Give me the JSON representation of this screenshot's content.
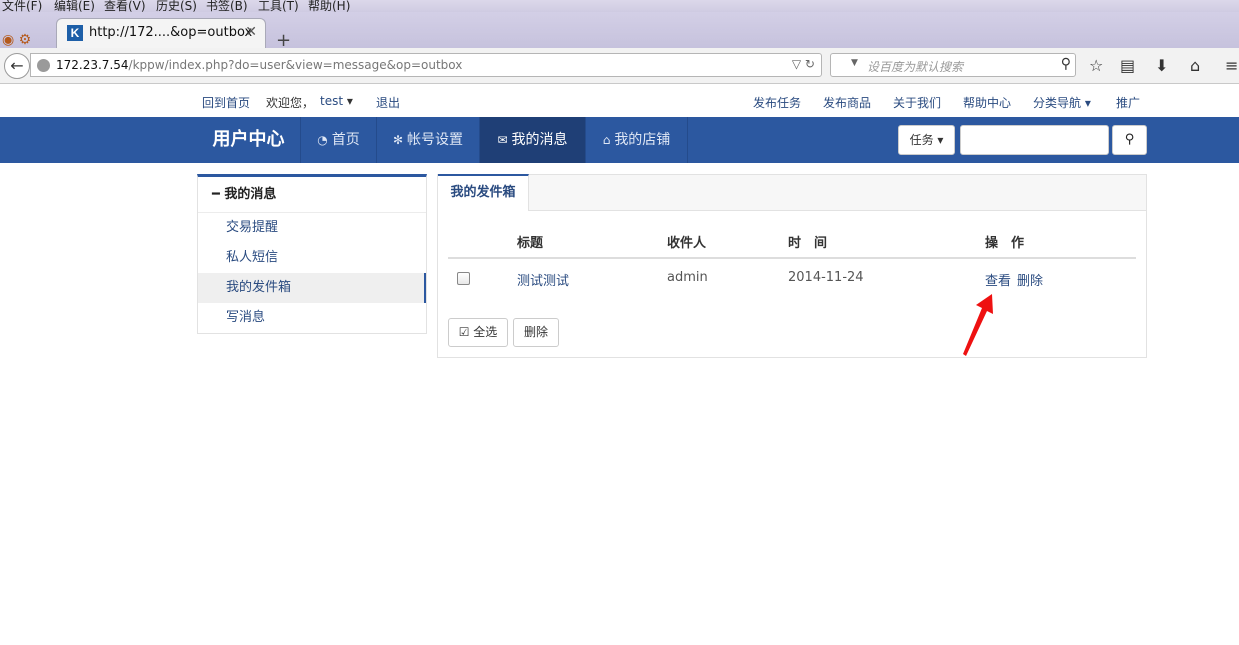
{
  "browser": {
    "menu": [
      "文件(F)",
      "编辑(E)",
      "查看(V)",
      "历史(S)",
      "书签(B)",
      "工具(T)",
      "帮助(H)"
    ],
    "tab_title": "http://172....&op=outbox",
    "tab_favicon": "K",
    "url_host": "172.23.7.54",
    "url_path": "/kppw/index.php?do=user&view=message&op=outbox",
    "search_placeholder": "设百度为默认搜索"
  },
  "site_top": {
    "home_link": "回到首页",
    "welcome": "欢迎您，",
    "username": "test",
    "logout": "退出",
    "right_links": [
      "发布任务",
      "发布商品",
      "关于我们",
      "帮助中心",
      "分类导航",
      "推广"
    ]
  },
  "main_nav": {
    "brand": "用户中心",
    "items": [
      {
        "label": "首页",
        "icon": "dashboard-icon"
      },
      {
        "label": "帐号设置",
        "icon": "gears-icon"
      },
      {
        "label": "我的消息",
        "icon": "envelope-icon"
      },
      {
        "label": "我的店铺",
        "icon": "home-icon"
      }
    ],
    "active_index": 2,
    "task_select": "任务",
    "accent_color": "#2c58a0"
  },
  "sidebar": {
    "title": "我的消息",
    "items": [
      "交易提醒",
      "私人短信",
      "我的发件箱",
      "写消息"
    ],
    "active_index": 2
  },
  "panel": {
    "tab": "我的发件箱",
    "columns": [
      "标题",
      "收件人",
      "时　间",
      "操　作"
    ],
    "rows": [
      {
        "title": "测试测试",
        "recipient": "admin",
        "time": "2014-11-24",
        "actions": [
          "查看",
          "删除"
        ]
      }
    ],
    "select_all": "全选",
    "delete": "删除"
  }
}
